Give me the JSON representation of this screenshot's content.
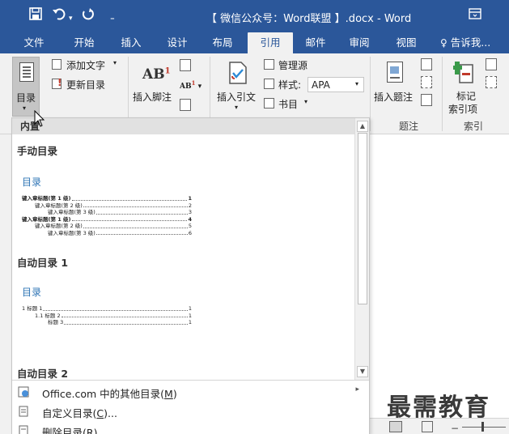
{
  "title_bar": {
    "document_title": "【 微信公众号：Word联盟 】.docx - Word",
    "icons": [
      "save-icon",
      "undo-icon",
      "redo-icon",
      "customize-quick-access-icon",
      "ribbon-display-options-icon"
    ]
  },
  "tabs": [
    {
      "label": "文件",
      "active": false
    },
    {
      "label": "开始",
      "active": false
    },
    {
      "label": "插入",
      "active": false
    },
    {
      "label": "设计",
      "active": false
    },
    {
      "label": "布局",
      "active": false
    },
    {
      "label": "引用",
      "active": true
    },
    {
      "label": "邮件",
      "active": false
    },
    {
      "label": "审阅",
      "active": false
    },
    {
      "label": "视图",
      "active": false
    },
    {
      "label": "告诉我...",
      "active": false
    }
  ],
  "ribbon": {
    "toc_button": "目录",
    "add_text": "添加文字",
    "update_toc": "更新目录",
    "insert_footnote": "插入脚注",
    "insert_citation": "插入引文",
    "manage_sources": "管理源",
    "style_label": "样式:",
    "style_value": "APA",
    "bibliography": "书目",
    "insert_caption": "插入题注",
    "mark_entry_line1": "标记",
    "mark_entry_line2": "索引项",
    "group_captions": "题注",
    "group_index": "索引"
  },
  "panel": {
    "header": "内置",
    "manual_toc_title": "手动目录",
    "auto_toc1_title": "自动目录 1",
    "auto_toc2_title": "自动目录 2",
    "preview_heading": "目录",
    "manual_entries": [
      {
        "text": "键入章标题(第 1 级)",
        "page": "1",
        "level": 1
      },
      {
        "text": "键入章标题(第 2 级)",
        "page": "2",
        "level": 2
      },
      {
        "text": "键入章标题(第 3 级)",
        "page": "3",
        "level": 3
      },
      {
        "text": "键入章标题(第 1 级)",
        "page": "4",
        "level": 1
      },
      {
        "text": "键入章标题(第 2 级)",
        "page": "5",
        "level": 2
      },
      {
        "text": "键入章标题(第 3 级)",
        "page": "6",
        "level": 3
      }
    ],
    "auto_entries": [
      {
        "text": "1 标题 1",
        "page": "1",
        "level": 1
      },
      {
        "text": "1.1 标题 2",
        "page": "1",
        "level": 2
      },
      {
        "text": "标题 3",
        "page": "1",
        "level": 3
      }
    ],
    "menu": [
      {
        "label": "Office.com 中的其他目录(",
        "key": "M",
        "suffix": ")",
        "has_submenu": true
      },
      {
        "label": "自定义目录(",
        "key": "C",
        "suffix": ")...",
        "has_submenu": false
      },
      {
        "label": "删除目录(",
        "key": "R",
        "suffix": ")",
        "has_submenu": false
      }
    ]
  },
  "watermark": "最需教育",
  "colors": {
    "accent": "#2b579a",
    "toc_heading": "#2e74b5"
  }
}
